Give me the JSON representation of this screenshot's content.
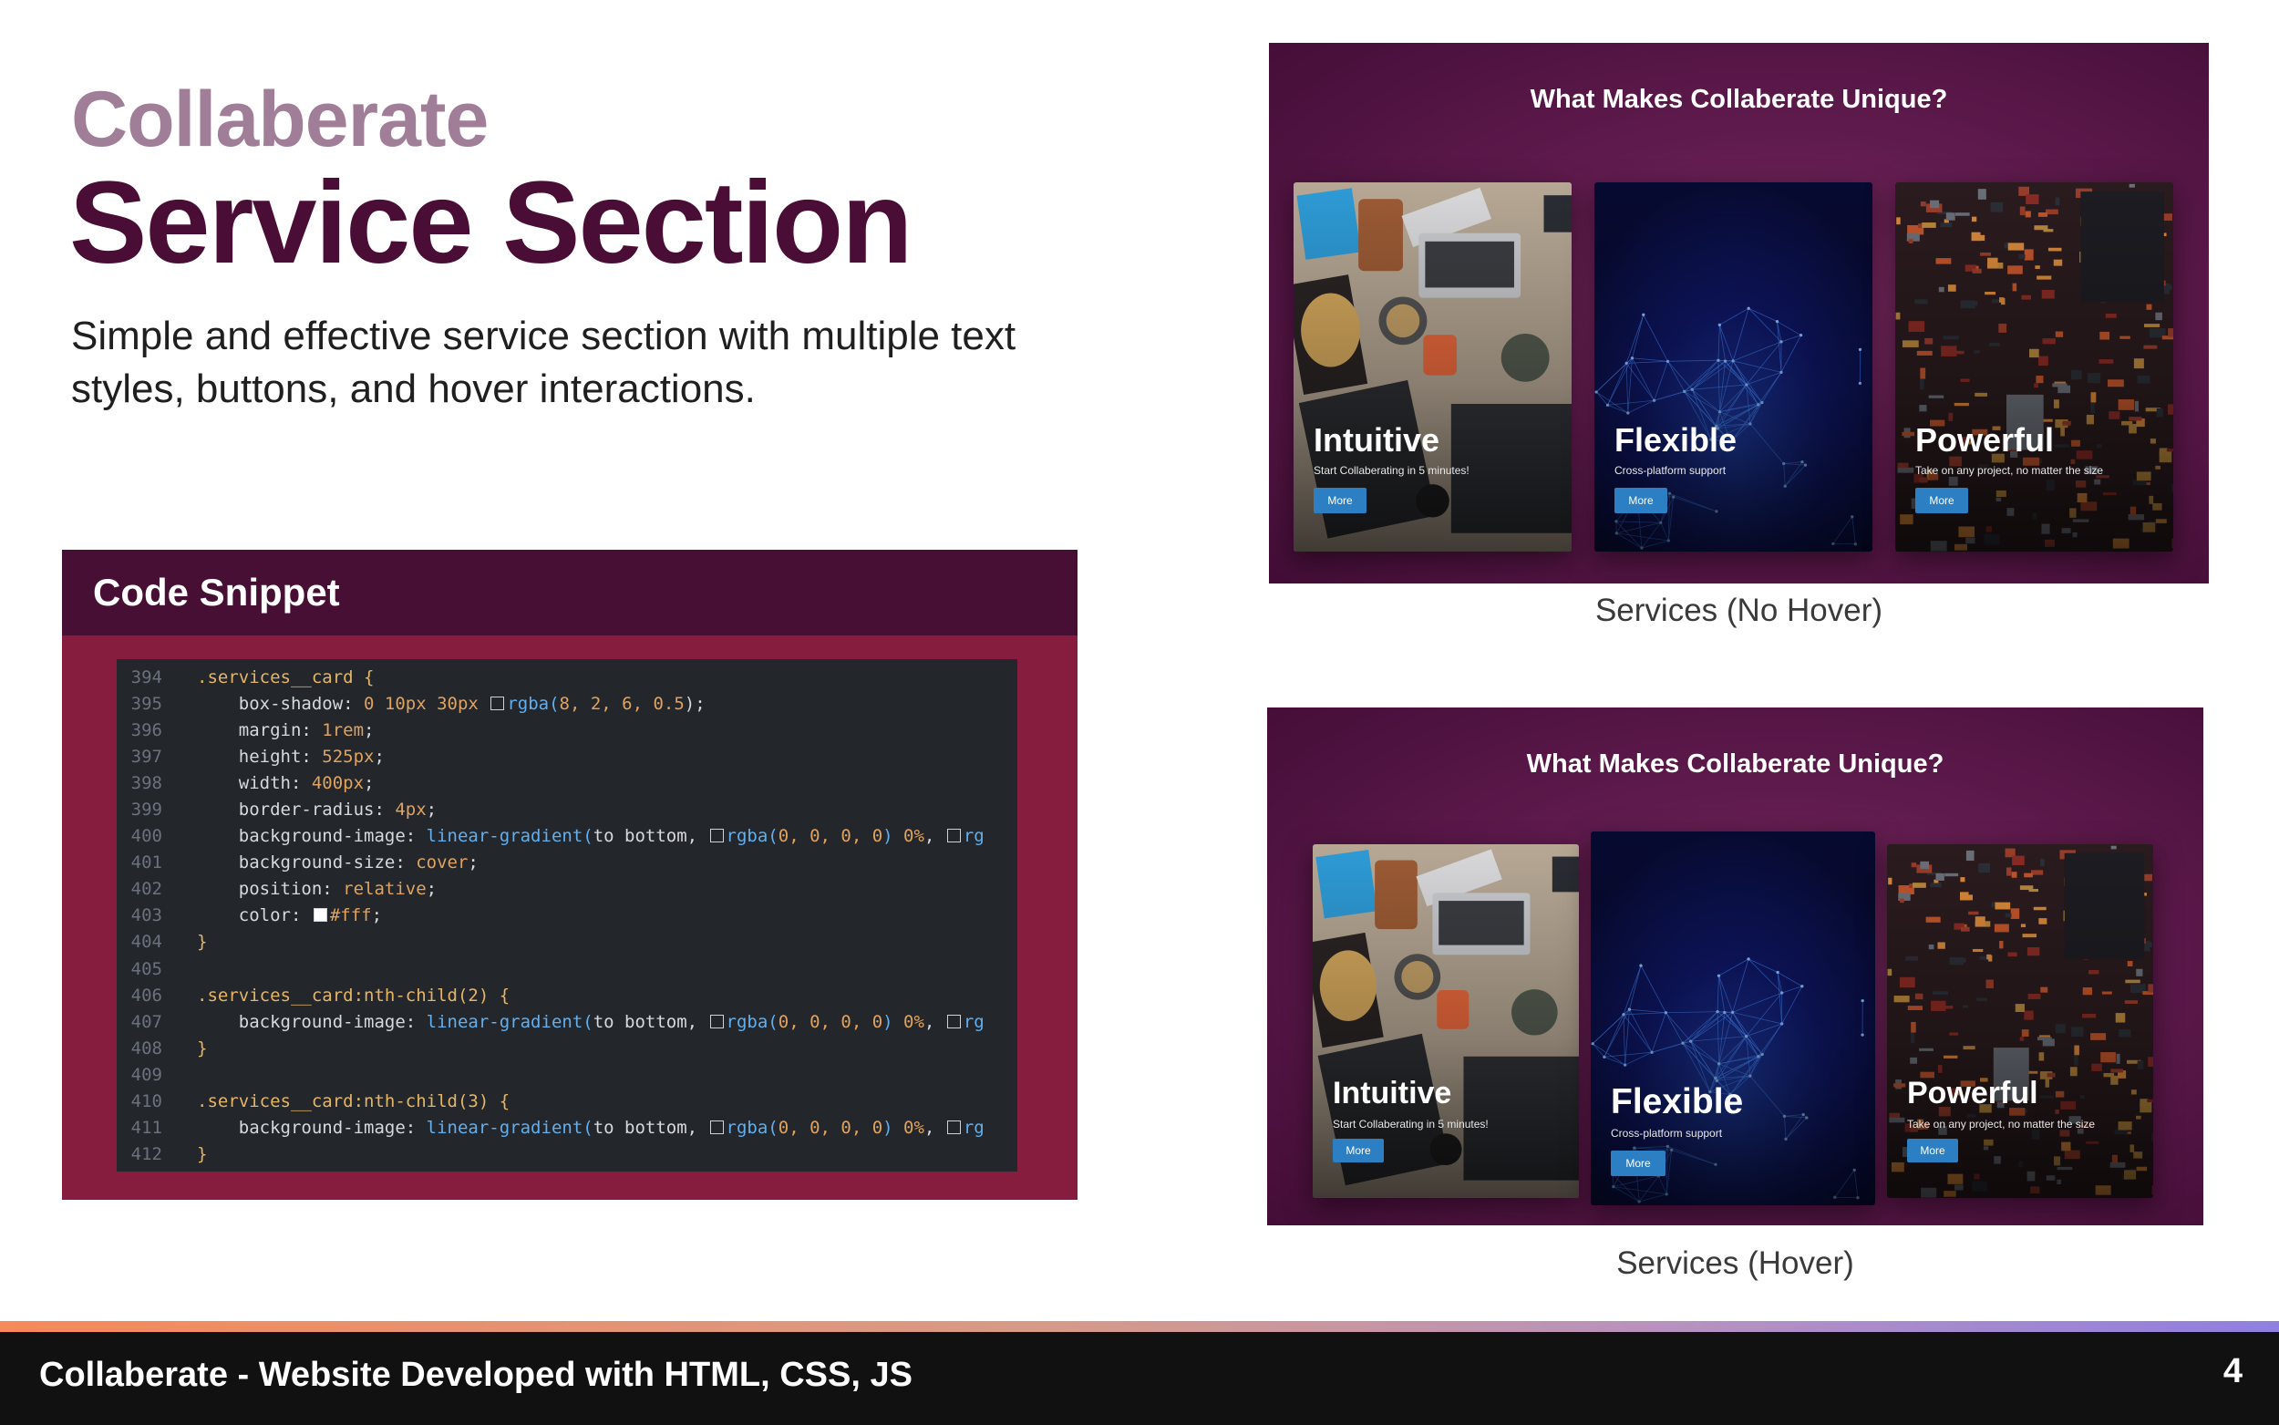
{
  "header": {
    "eyebrow": "Collaberate",
    "title": "Service Section",
    "description": "Simple and effective service section with multiple text styles, buttons, and hover interactions."
  },
  "snippet": {
    "title": "Code Snippet",
    "lines": [
      {
        "n": "394",
        "tokens": [
          {
            "t": ".services__card {",
            "c": "sel"
          }
        ]
      },
      {
        "n": "395",
        "tokens": [
          {
            "t": "    box-shadow: ",
            "c": "prop"
          },
          {
            "t": "0 10px 30px ",
            "c": "num"
          },
          {
            "sw": "dark"
          },
          {
            "t": "rgba(",
            "c": "fn"
          },
          {
            "t": "8, 2, 6, 0.5",
            "c": "num"
          },
          {
            "t": ");",
            "c": "prop"
          }
        ]
      },
      {
        "n": "396",
        "tokens": [
          {
            "t": "    margin: ",
            "c": "prop"
          },
          {
            "t": "1rem",
            "c": "num"
          },
          {
            "t": ";",
            "c": "prop"
          }
        ]
      },
      {
        "n": "397",
        "tokens": [
          {
            "t": "    height: ",
            "c": "prop"
          },
          {
            "t": "525px",
            "c": "num"
          },
          {
            "t": ";",
            "c": "prop"
          }
        ]
      },
      {
        "n": "398",
        "tokens": [
          {
            "t": "    width: ",
            "c": "prop"
          },
          {
            "t": "400px",
            "c": "num"
          },
          {
            "t": ";",
            "c": "prop"
          }
        ]
      },
      {
        "n": "399",
        "tokens": [
          {
            "t": "    border-radius: ",
            "c": "prop"
          },
          {
            "t": "4px",
            "c": "num"
          },
          {
            "t": ";",
            "c": "prop"
          }
        ]
      },
      {
        "n": "400",
        "tokens": [
          {
            "t": "    background-image: ",
            "c": "prop"
          },
          {
            "t": "linear-gradient(",
            "c": "fn"
          },
          {
            "t": "to bottom, ",
            "c": "kw"
          },
          {
            "sw": "dark"
          },
          {
            "t": "rgba(",
            "c": "fn"
          },
          {
            "t": "0, 0, 0, 0",
            "c": "num"
          },
          {
            "t": ") ",
            "c": "fn"
          },
          {
            "t": "0%",
            "c": "num"
          },
          {
            "t": ", ",
            "c": "prop"
          },
          {
            "sw": "dark"
          },
          {
            "t": "rg",
            "c": "fn"
          }
        ]
      },
      {
        "n": "401",
        "tokens": [
          {
            "t": "    background-size: ",
            "c": "prop"
          },
          {
            "t": "cover",
            "c": "val"
          },
          {
            "t": ";",
            "c": "prop"
          }
        ]
      },
      {
        "n": "402",
        "tokens": [
          {
            "t": "    position: ",
            "c": "prop"
          },
          {
            "t": "relative",
            "c": "val"
          },
          {
            "t": ";",
            "c": "prop"
          }
        ]
      },
      {
        "n": "403",
        "tokens": [
          {
            "t": "    color: ",
            "c": "prop"
          },
          {
            "sw": "white"
          },
          {
            "t": "#fff",
            "c": "val"
          },
          {
            "t": ";",
            "c": "prop"
          }
        ]
      },
      {
        "n": "404",
        "tokens": [
          {
            "t": "}",
            "c": "sel"
          }
        ]
      },
      {
        "n": "405",
        "tokens": []
      },
      {
        "n": "406",
        "tokens": [
          {
            "t": ".services__card:nth-child(2) {",
            "c": "sel"
          }
        ]
      },
      {
        "n": "407",
        "tokens": [
          {
            "t": "    background-image: ",
            "c": "prop"
          },
          {
            "t": "linear-gradient(",
            "c": "fn"
          },
          {
            "t": "to bottom, ",
            "c": "kw"
          },
          {
            "sw": "dark"
          },
          {
            "t": "rgba(",
            "c": "fn"
          },
          {
            "t": "0, 0, 0, 0",
            "c": "num"
          },
          {
            "t": ") ",
            "c": "fn"
          },
          {
            "t": "0%",
            "c": "num"
          },
          {
            "t": ", ",
            "c": "prop"
          },
          {
            "sw": "dark"
          },
          {
            "t": "rg",
            "c": "fn"
          }
        ]
      },
      {
        "n": "408",
        "tokens": [
          {
            "t": "}",
            "c": "sel"
          }
        ]
      },
      {
        "n": "409",
        "tokens": []
      },
      {
        "n": "410",
        "tokens": [
          {
            "t": ".services__card:nth-child(3) {",
            "c": "sel"
          }
        ]
      },
      {
        "n": "411",
        "tokens": [
          {
            "t": "    background-image: ",
            "c": "prop"
          },
          {
            "t": "linear-gradient(",
            "c": "fn"
          },
          {
            "t": "to bottom, ",
            "c": "kw"
          },
          {
            "sw": "dark"
          },
          {
            "t": "rgba(",
            "c": "fn"
          },
          {
            "t": "0, 0, 0, 0",
            "c": "num"
          },
          {
            "t": ") ",
            "c": "fn"
          },
          {
            "t": "0%",
            "c": "num"
          },
          {
            "t": ", ",
            "c": "prop"
          },
          {
            "sw": "dark"
          },
          {
            "t": "rg",
            "c": "fn"
          }
        ]
      },
      {
        "n": "412",
        "tokens": [
          {
            "t": "}",
            "c": "sel"
          }
        ]
      }
    ]
  },
  "preview_nohover": {
    "heading": "What Makes Collaberate Unique?",
    "caption": "Services (No Hover)",
    "cards": [
      {
        "title": "Intuitive",
        "subtitle": "Start Collaberating in 5 minutes!",
        "button": "More",
        "art": "desk"
      },
      {
        "title": "Flexible",
        "subtitle": "Cross-platform support",
        "button": "More",
        "art": "network"
      },
      {
        "title": "Powerful",
        "subtitle": "Take on any project, no matter the size",
        "button": "More",
        "art": "circuit"
      }
    ]
  },
  "preview_hover": {
    "heading": "What Makes Collaberate Unique?",
    "caption": "Services (Hover)",
    "cards": [
      {
        "title": "Intuitive",
        "subtitle": "Start Collaberating in 5 minutes!",
        "button": "More",
        "art": "desk"
      },
      {
        "title": "Flexible",
        "subtitle": "Cross-platform support",
        "button": "More",
        "art": "network"
      },
      {
        "title": "Powerful",
        "subtitle": "Take on any project, no matter the size",
        "button": "More",
        "art": "circuit"
      }
    ]
  },
  "footer": {
    "text": "Collaberate - Website Developed with  HTML, CSS, JS",
    "page": "4"
  },
  "colors": {
    "brand_dark": "#4a0d35",
    "brand_muted": "#a17e98",
    "snippet_frame": "#861c3e",
    "button_blue": "#2d7fc4"
  }
}
